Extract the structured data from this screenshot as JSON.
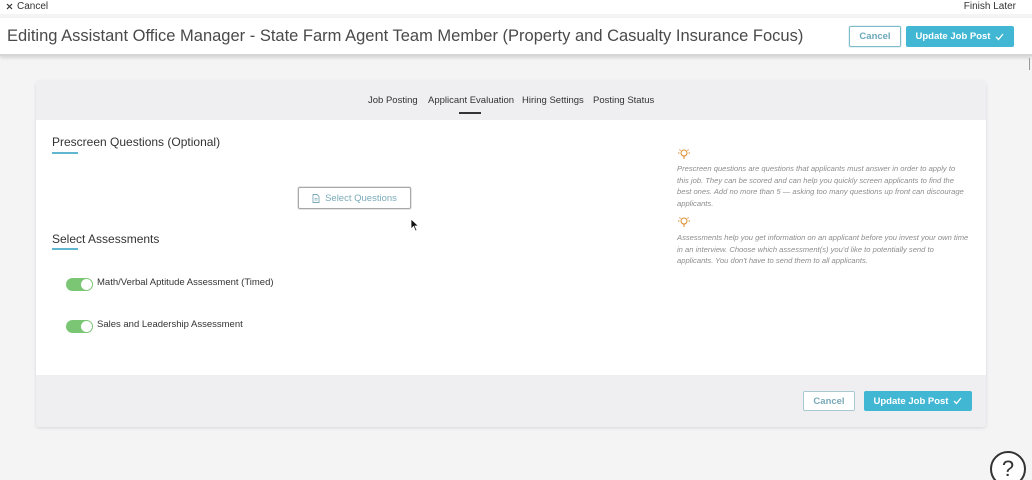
{
  "topbar": {
    "cancel_label": "Cancel",
    "finish_later_label": "Finish Later"
  },
  "header": {
    "title": "Editing Assistant Office Manager - State Farm Agent Team Member (Property and Casualty Insurance Focus)",
    "cancel_label": "Cancel",
    "update_label": "Update Job Post"
  },
  "tabs": [
    {
      "label": "Job Posting",
      "active": false
    },
    {
      "label": "Applicant Evaluation",
      "active": true
    },
    {
      "label": "Hiring Settings",
      "active": false
    },
    {
      "label": "Posting Status",
      "active": false
    }
  ],
  "prescreen": {
    "title": "Prescreen Questions (Optional)",
    "button_label": "Select Questions"
  },
  "assessments": {
    "title": "Select Assessments",
    "items": [
      {
        "label": "Math/Verbal Aptitude Assessment (Timed)",
        "enabled": true
      },
      {
        "label": "Sales and Leadership Assessment",
        "enabled": true
      }
    ]
  },
  "tips": [
    {
      "text": "Prescreen questions are questions that applicants must answer in order to apply to this job. They can be scored and can help you quickly screen applicants to find the best ones. Add no more than 5 — asking too many questions up front can discourage applicants."
    },
    {
      "text": "Assessments help you get information on an applicant before you invest your own time in an interview. Choose which assessment(s) you'd like to potentially send to applicants. You don't have to send them to all applicants."
    }
  ],
  "footer": {
    "cancel_label": "Cancel",
    "update_label": "Update Job Post"
  },
  "help": {
    "label": "?"
  },
  "colors": {
    "accent": "#42b7d4",
    "toggle_on": "#7bc675",
    "tip_icon": "#d98c2a"
  },
  "icons": {
    "cancel": "close-icon",
    "update": "checkmark-icon",
    "select_questions": "document-icon",
    "tip": "lightbulb-icon",
    "help": "question-icon"
  }
}
